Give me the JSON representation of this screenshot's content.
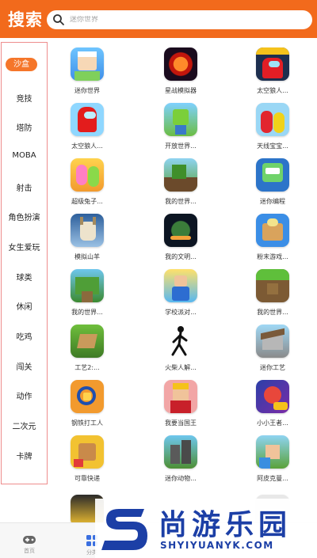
{
  "header": {
    "title": "搜索",
    "search_placeholder": "迷你世界"
  },
  "colors": {
    "brand": "#f26a1c",
    "active_category": "#f5762a",
    "sidebar_border": "#ee8d8d"
  },
  "sidebar": {
    "categories": [
      "沙盒",
      "竞技",
      "塔防",
      "MOBA",
      "射击",
      "角色扮演",
      "女生爱玩",
      "球类",
      "休闲",
      "吃鸡",
      "闯关",
      "动作",
      "二次元",
      "卡牌"
    ],
    "active_index": 0
  },
  "apps": [
    {
      "label": "迷你世界",
      "icon": "mini-world-icon"
    },
    {
      "label": "星战模拟器",
      "icon": "star-war-simulator-icon"
    },
    {
      "label": "太空狼人...",
      "icon": "space-werewolf-icon"
    },
    {
      "label": "太空狼人...",
      "icon": "among-us-icon"
    },
    {
      "label": "开放世界...",
      "icon": "open-world-icon"
    },
    {
      "label": "天线宝宝...",
      "icon": "teletubbies-icon"
    },
    {
      "label": "超级兔子...",
      "icon": "super-bunny-icon"
    },
    {
      "label": "我的世界...",
      "icon": "my-world-icon"
    },
    {
      "label": "迷你编程",
      "icon": "mini-programming-icon"
    },
    {
      "label": "模拟山羊",
      "icon": "goat-simulator-icon"
    },
    {
      "label": "我的文明...",
      "icon": "my-civilization-icon"
    },
    {
      "label": "粉末游戏...",
      "icon": "powder-game-icon"
    },
    {
      "label": "我的世界...",
      "icon": "my-world-jungle-icon"
    },
    {
      "label": "学校派对...",
      "icon": "school-party-icon"
    },
    {
      "label": "我的世界...",
      "icon": "my-world-grass-icon"
    },
    {
      "label": "工艺2:...",
      "icon": "craft-2-icon"
    },
    {
      "label": "火柴人解...",
      "icon": "stickman-icon"
    },
    {
      "label": "迷你工艺",
      "icon": "mini-craft-icon"
    },
    {
      "label": "钢铁打工人",
      "icon": "steel-worker-icon"
    },
    {
      "label": "我要当国王",
      "icon": "be-the-king-icon"
    },
    {
      "label": "小小王者...",
      "icon": "little-king-icon"
    },
    {
      "label": "可靠快递",
      "icon": "reliable-delivery-icon"
    },
    {
      "label": "迷你动物...",
      "icon": "mini-animal-icon"
    },
    {
      "label": "阿皮克曼...",
      "icon": "apickman-icon"
    }
  ],
  "bottom_tabs": [
    {
      "label": "首页",
      "icon": "gamepad-icon"
    },
    {
      "label": "分类",
      "icon": "category-icon"
    }
  ],
  "watermark": {
    "text": "尚游乐园",
    "sub": "SHYIYUANYK.COM",
    "logo": "s-logo"
  }
}
